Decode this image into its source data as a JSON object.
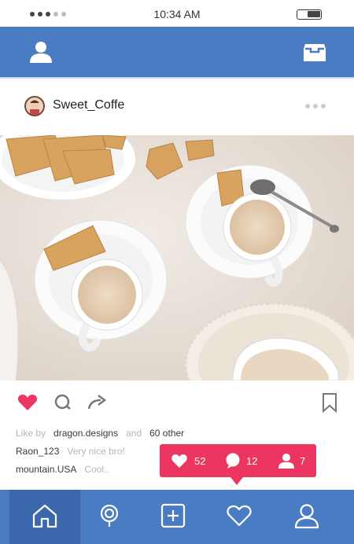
{
  "status_bar": {
    "time": "10:34 AM",
    "signal_dots_active": 3,
    "signal_dots_total": 5,
    "battery_level": 0.55
  },
  "top_bar": {
    "color": "#4a7cc4",
    "left_icon": "profile-icon",
    "right_icon": "inbox-icon"
  },
  "post": {
    "username": "Sweet_Coffe",
    "more_icon": "more-dots-icon",
    "liked": true,
    "like_color": "#ec3560"
  },
  "likes": {
    "prefix": "Like by",
    "user": "dragon.designs",
    "and": "and",
    "others": "60 other"
  },
  "comments": [
    {
      "user": "Raon_123",
      "text": "Very nice bro!"
    },
    {
      "user": "mountain.USA",
      "text": "Cool.."
    }
  ],
  "notification": {
    "likes": "52",
    "comments": "12",
    "followers": "7"
  },
  "bottom_nav": {
    "items": [
      "home-icon",
      "search-icon",
      "add-icon",
      "heart-icon",
      "profile-icon"
    ],
    "active_index": 0
  }
}
